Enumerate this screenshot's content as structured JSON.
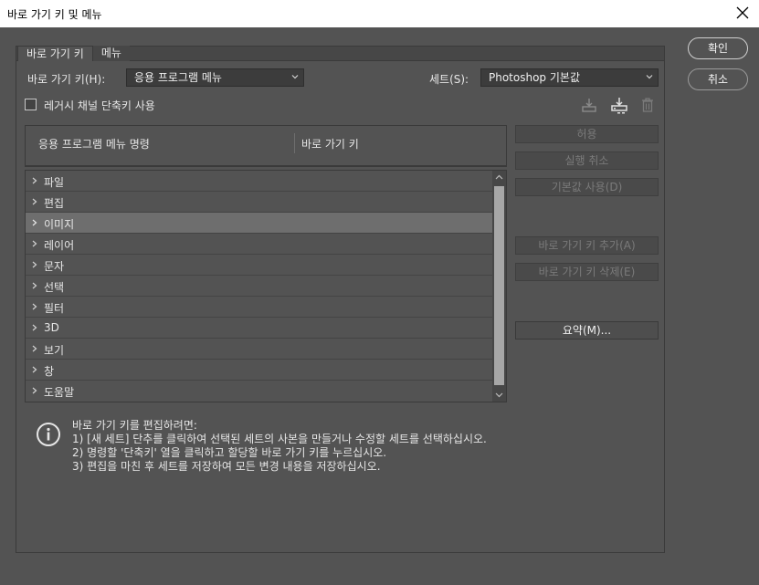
{
  "window": {
    "title": "바로 가기 키 및 메뉴"
  },
  "tabs": [
    {
      "label": "바로 가기 키",
      "active": true
    },
    {
      "label": "메뉴",
      "active": false
    }
  ],
  "shortcuts_for": {
    "label": "바로 가기 키(H):",
    "value": "응용 프로그램 메뉴"
  },
  "set": {
    "label": "세트(S):",
    "value": "Photoshop 기본값"
  },
  "legacy_checkbox": {
    "label": "레거시 채널 단축키 사용",
    "checked": false
  },
  "table": {
    "col1": "응용 프로그램 메뉴 명령",
    "col2": "바로 가기 키",
    "rows": [
      {
        "label": "파일"
      },
      {
        "label": "편집"
      },
      {
        "label": "이미지"
      },
      {
        "label": "레이어"
      },
      {
        "label": "문자"
      },
      {
        "label": "선택"
      },
      {
        "label": "필터"
      },
      {
        "label": "3D"
      },
      {
        "label": "보기"
      },
      {
        "label": "창"
      },
      {
        "label": "도움말"
      }
    ],
    "selected_index": 2
  },
  "side_buttons": {
    "accept": "허용",
    "undo": "실행 취소",
    "use_default": "기본값 사용(D)",
    "add_shortcut": "바로 가기 키 추가(A)",
    "delete_shortcut": "바로 가기 키 삭제(E)",
    "summarize": "요약(M)..."
  },
  "dialog_buttons": {
    "ok": "확인",
    "cancel": "취소"
  },
  "info": {
    "heading": "바로 가기 키를 편집하려면:",
    "lines": [
      "1) [새 세트] 단추를 클릭하여 선택된 세트의 사본을 만들거나 수정할 세트를 선택하십시오.",
      "2) 명령할 '단축키' 열을 클릭하고 할당할 바로 가기 키를 누르십시오.",
      "3) 편집을 마친 후 세트를 저장하여 모든 변경 내용을 저장하십시오."
    ]
  },
  "icons": {
    "save_set": "save-set-icon",
    "new_set": "new-set-icon",
    "delete_set": "trash-icon",
    "info": "info-icon",
    "close": "close-icon"
  },
  "colors": {
    "background": "#535353",
    "selected_row": "#6e6e6e",
    "title_bar": "#ffffff"
  }
}
